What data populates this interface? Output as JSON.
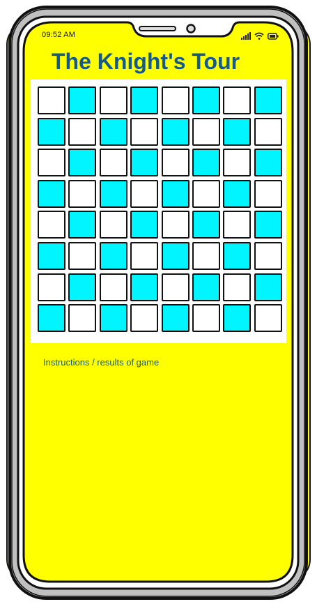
{
  "status_bar": {
    "time": "09:52 AM",
    "icons": [
      "signal-icon",
      "wifi-icon",
      "battery-icon"
    ]
  },
  "header": {
    "title": "The Knight's Tour"
  },
  "board": {
    "rows": 8,
    "cols": 8,
    "light_color": "#ffffff",
    "dark_color": "#00f5ff",
    "first_square": "light"
  },
  "instructions": {
    "text": "Instructions / results of game"
  },
  "colors": {
    "screen_background": "#ffff00",
    "phone_body": "#c0c0c0",
    "title_color": "#155a8a",
    "outline": "#111111"
  }
}
